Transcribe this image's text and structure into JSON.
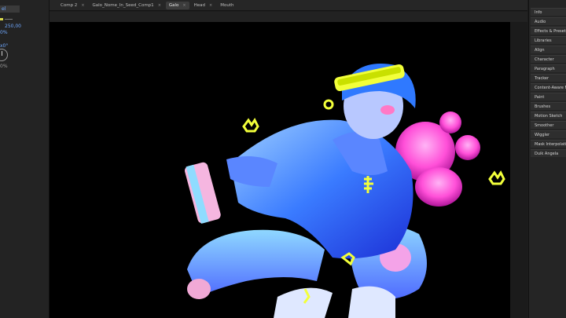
{
  "left_panel": {
    "input_value": "el",
    "value1": "250,00",
    "percent1": "0%",
    "angle_label": "x0°",
    "percent2": "0%"
  },
  "tabs": [
    {
      "label": "Comp 2",
      "active": false
    },
    {
      "label": "Galo_Nome_In_Seed_Comp1",
      "active": false
    },
    {
      "label": "Galo",
      "active": true
    },
    {
      "label": "Head",
      "active": false
    },
    {
      "label": "Mouth",
      "active": false
    }
  ],
  "tab_close_glyph": "×",
  "right_panel": {
    "items": [
      "Info",
      "Audio",
      "Effects & Presets",
      "Libraries",
      "Align",
      "Character",
      "Paragraph",
      "Tracker",
      "Content-Aware Fill",
      "Paint",
      "Brushes",
      "Motion Sketch",
      "Smoother",
      "Wiggler",
      "Mask Interpolation",
      "Duik Angela"
    ]
  },
  "colors": {
    "accent_blue": "#6fa8ff",
    "illustration_blue": "#3a7bff",
    "illustration_pink": "#ff4fd8",
    "illustration_yellow": "#f2ff3a"
  }
}
